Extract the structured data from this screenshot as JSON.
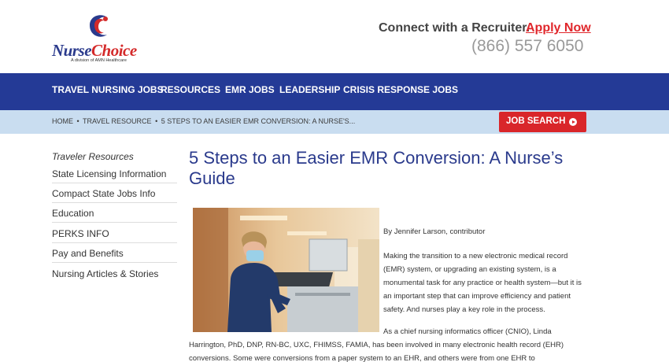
{
  "header": {
    "logo_nurse": "Nurse",
    "logo_choice": "Choice",
    "logo_sub": "A division of AMN Healthcare",
    "connect_text": "Connect with a Recruiter.",
    "apply_label": "Apply Now",
    "phone": "(866) 557 6050"
  },
  "nav": {
    "items": [
      "TRAVEL NURSING JOBS",
      "RESOURCES",
      "EMR JOBS",
      "LEADERSHIP",
      "CRISIS RESPONSE JOBS"
    ]
  },
  "breadcrumb": {
    "items": [
      "HOME",
      "TRAVEL RESOURCE",
      "5 STEPS TO AN EASIER EMR CONVERSION: A NURSE'S..."
    ],
    "separator": "•"
  },
  "job_search": {
    "label": "JOB SEARCH"
  },
  "sidebar": {
    "title": "Traveler Resources",
    "items": [
      "State Licensing Information",
      "Compact State Jobs Info",
      "Education",
      "PERKS INFO",
      "Pay and Benefits",
      "Nursing Articles & Stories"
    ]
  },
  "article": {
    "title": "5 Steps to an Easier EMR Conversion: A Nurse’s Guide",
    "byline": "By Jennifer Larson, contributor",
    "para1": "Making the transition to a new electronic medical record (EMR) system, or upgrading an existing system, is a monumental task for any practice or health system—but it is an important step that can improve efficiency and patient safety. And nurses play a key role in the process.",
    "para2": "As a chief nursing informatics officer (CNIO), Linda Harrington, PhD, DNP, RN-BC, UXC, FHIMSS, FAMIA, has been involved in many electronic health record (EHR) conversions. Some were conversions from a paper system to an EHR, and others were from one EHR to"
  },
  "colors": {
    "nav_bg": "#243a96",
    "crumb_bg": "#c9ddf0",
    "accent_red": "#d9262a",
    "title_blue": "#2a3a8c"
  }
}
